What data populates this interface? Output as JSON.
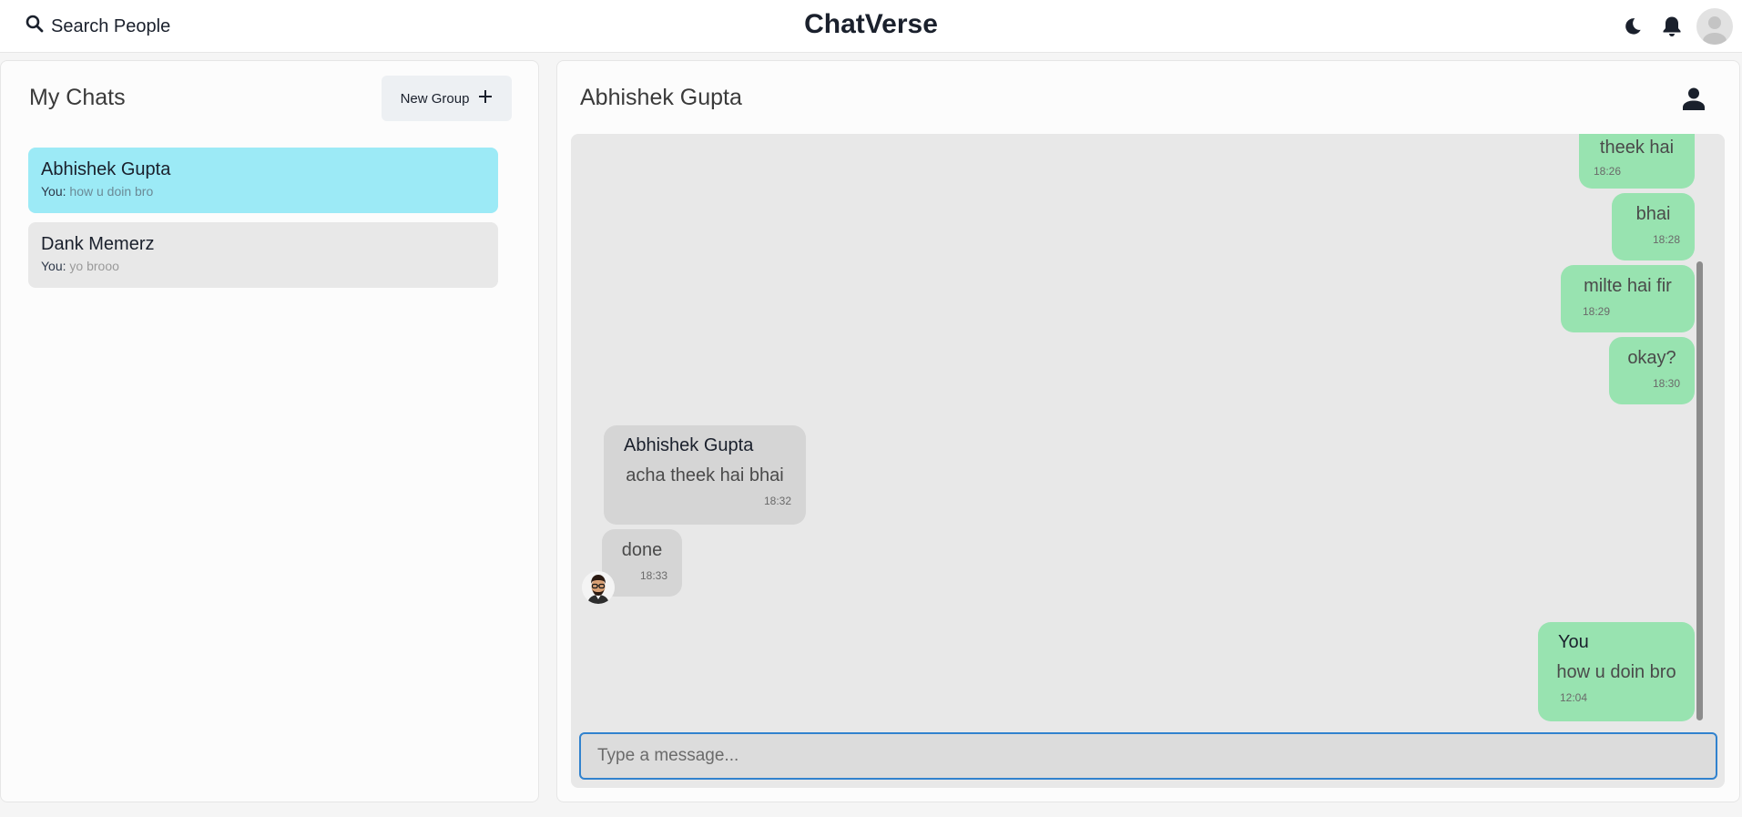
{
  "header": {
    "search_label": "Search People",
    "app_title": "ChatVerse",
    "icons": [
      "search-icon",
      "moon-icon",
      "bell-icon",
      "avatar"
    ]
  },
  "sidebar": {
    "title": "My Chats",
    "new_group_label": "New Group",
    "chats": [
      {
        "name": "Abhishek Gupta",
        "sender": "You:",
        "preview": "how u doin bro",
        "active": true
      },
      {
        "name": "Dank Memerz",
        "sender": "You:",
        "preview": "yo brooo",
        "active": false
      }
    ]
  },
  "conversation": {
    "title": "Abhishek Gupta",
    "messages": [
      {
        "text": "theek hai",
        "time": "18:26",
        "from": "me"
      },
      {
        "text": "bhai",
        "time": "18:28",
        "from": "me"
      },
      {
        "text": "milte hai fir",
        "time": "18:29",
        "from": "me"
      },
      {
        "text": "okay?",
        "time": "18:30",
        "from": "me"
      },
      {
        "sender": "Abhishek Gupta",
        "text": "acha theek hai bhai",
        "time": "18:32",
        "from": "them"
      },
      {
        "text": "done",
        "time": "18:33",
        "from": "them"
      },
      {
        "sender": "You",
        "text": "how u doin bro",
        "time": "12:04",
        "from": "me"
      }
    ],
    "input_placeholder": "Type a message..."
  },
  "colors": {
    "active_chat": "#9ceaf6",
    "my_bubble": "#98e3b0",
    "their_bubble": "#d5d5d5",
    "input_border": "#3182ce"
  }
}
